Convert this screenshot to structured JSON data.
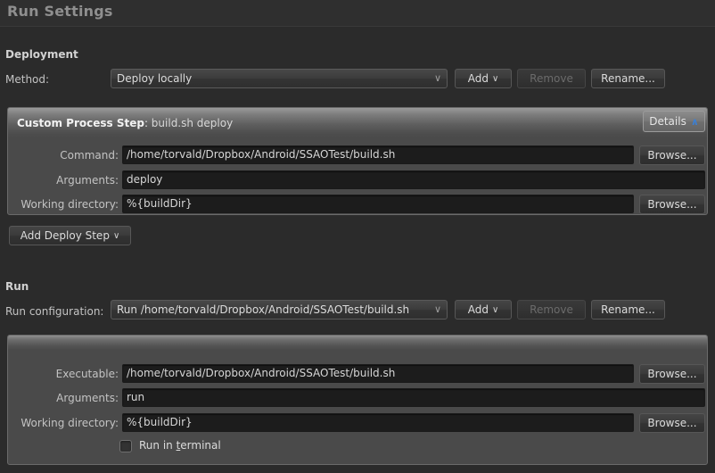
{
  "window": {
    "title": "Run Settings"
  },
  "deployment": {
    "heading": "Deployment",
    "method_label": "Method:",
    "method_value": "Deploy locally",
    "add_label": "Add",
    "add_chevron": "∨",
    "remove_label": "Remove",
    "rename_label": "Rename...",
    "step": {
      "title_bold": "Custom Process Step",
      "title_sep": ": ",
      "title_rest": "build.sh deploy",
      "details_label": "Details",
      "details_chevron": "∧",
      "command_label": "Command:",
      "command_value": "/home/torvald/Dropbox/Android/SSAOTest/build.sh",
      "command_browse": "Browse...",
      "arguments_label": "Arguments:",
      "arguments_value": "deploy",
      "workdir_label": "Working directory:",
      "workdir_value": "%{buildDir}",
      "workdir_browse": "Browse..."
    },
    "add_deploy_step_label": "Add Deploy Step",
    "add_deploy_step_chevron": "∨"
  },
  "run": {
    "heading": "Run",
    "config_label": "Run configuration:",
    "config_value": "Run /home/torvald/Dropbox/Android/SSAOTest/build.sh",
    "add_label": "Add",
    "add_chevron": "∨",
    "remove_label": "Remove",
    "rename_label": "Rename...",
    "executable_label": "Executable:",
    "executable_value": "/home/torvald/Dropbox/Android/SSAOTest/build.sh",
    "executable_browse": "Browse...",
    "arguments_label": "Arguments:",
    "arguments_value": "run",
    "workdir_label": "Working directory:",
    "workdir_value": "%{buildDir}",
    "workdir_browse": "Browse...",
    "run_in_terminal_pre": "Run in ",
    "run_in_terminal_mnemonic": "t",
    "run_in_terminal_post": "erminal"
  },
  "colors": {
    "background": "#2b2b2b",
    "panel": "#4a4a4a",
    "field": "#1c1c1c",
    "accent_blue": "#3d7fd1",
    "text": "#c3c3c3"
  }
}
